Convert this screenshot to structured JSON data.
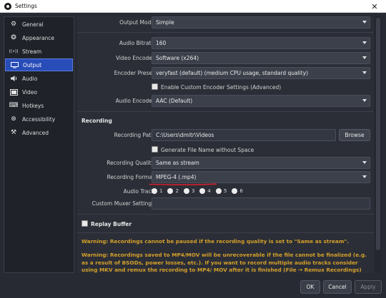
{
  "window": {
    "title": "Settings",
    "close_glyph": "✕"
  },
  "sidebar": {
    "items": [
      {
        "label": "General",
        "icon": "gear-icon",
        "glyph": "⚙"
      },
      {
        "label": "Appearance",
        "icon": "appearance-icon",
        "glyph": "❂"
      },
      {
        "label": "Stream",
        "icon": "stream-icon",
        "glyph": "((•))"
      },
      {
        "label": "Output",
        "icon": "output-icon",
        "glyph": "▭"
      },
      {
        "label": "Audio",
        "icon": "audio-icon",
        "glyph": "🔈"
      },
      {
        "label": "Video",
        "icon": "video-icon",
        "glyph": "▣"
      },
      {
        "label": "Hotkeys",
        "icon": "keyboard-icon",
        "glyph": "⌨"
      },
      {
        "label": "Accessibility",
        "icon": "accessibility-icon",
        "glyph": "⊛"
      },
      {
        "label": "Advanced",
        "icon": "advanced-icon",
        "glyph": "⚒"
      }
    ],
    "selected": "Output"
  },
  "output": {
    "output_mode": {
      "label": "Output Mode",
      "value": "Simple"
    },
    "audio_bitrate": {
      "label": "Audio Bitrate",
      "value": "160"
    },
    "video_encoder": {
      "label": "Video Encoder",
      "value": "Software (x264)"
    },
    "encoder_preset": {
      "label": "Encoder Preset",
      "value": "veryfast (default) (medium CPU usage, standard quality)"
    },
    "custom_encoder": {
      "label": "Enable Custom Encoder Settings (Advanced)",
      "checked": false
    },
    "audio_encoder": {
      "label": "Audio Encoder",
      "value": "AAC (Default)"
    }
  },
  "recording": {
    "section_title": "Recording",
    "path": {
      "label": "Recording Path",
      "value": "C:\\Users\\dmitr\\Videos",
      "browse": "Browse"
    },
    "no_space": {
      "label": "Generate File Name without Space",
      "checked": false
    },
    "quality": {
      "label": "Recording Quality",
      "value": "Same as stream"
    },
    "format": {
      "label": "Recording Format",
      "value": "MPEG-4 (.mp4)"
    },
    "audio_track": {
      "label": "Audio Track",
      "tracks": [
        "1",
        "2",
        "3",
        "4",
        "5",
        "6"
      ]
    },
    "muxer": {
      "label": "Custom Muxer Settings",
      "value": ""
    }
  },
  "replay_buffer": {
    "label": "Replay Buffer",
    "checked": false
  },
  "warnings": [
    "Warning: Recordings cannot be paused if the recording quality is set to \"Same as stream\".",
    "Warning: Recordings saved to MP4/MOV will be unrecoverable if the file cannot be finalized (e.g. as a result of BSODs, power losses, etc.). If you want to record multiple audio tracks consider using MKV and remux the recording to MP4/ MOV after it is finished (File → Remux Recordings)"
  ],
  "buttons": {
    "ok": "OK",
    "cancel": "Cancel",
    "apply": "Apply"
  },
  "colors": {
    "accent": "#284cb8",
    "warning": "#d4a02a",
    "annotation": "#d4202a"
  }
}
